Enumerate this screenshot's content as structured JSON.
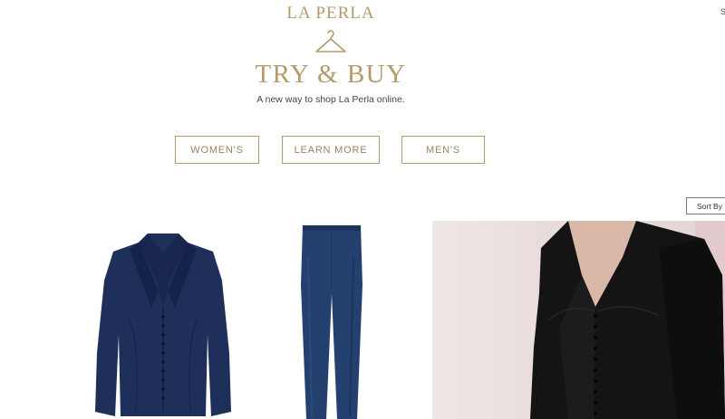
{
  "header": {
    "brand": "LA PERLA",
    "hanger_icon": "hanger-icon",
    "title": "TRY & BUY",
    "subtitle": "A new way to shop La Perla online.",
    "top_right_fragment": "S"
  },
  "nav": {
    "womens_label": "WOMEN'S",
    "learn_more_label": "LEARN MORE",
    "mens_label": "MEN'S"
  },
  "toolbar": {
    "sort_label": "Sort By"
  },
  "colors": {
    "accent": "#b49a6c",
    "navy": "#1e2f5a",
    "black": "#141414"
  }
}
